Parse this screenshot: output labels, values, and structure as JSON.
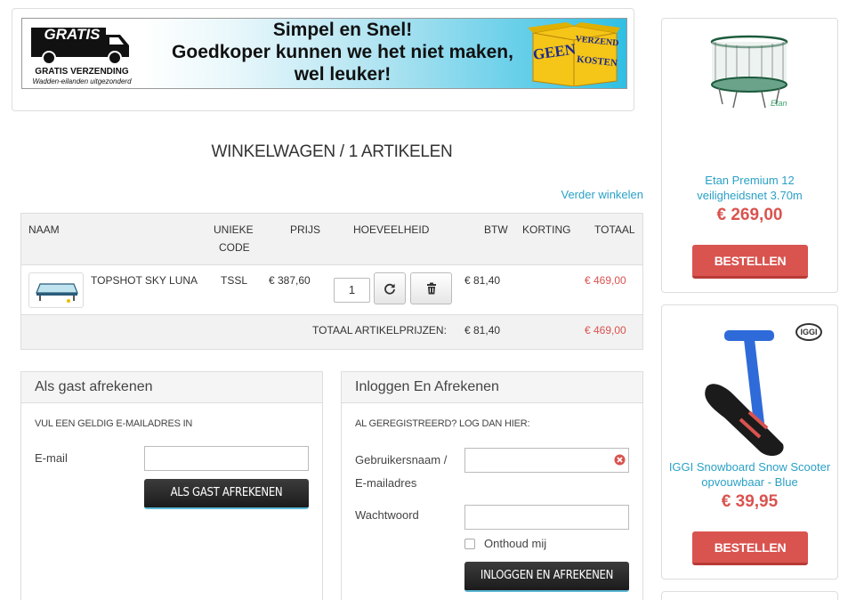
{
  "banner": {
    "gratis_badge": "GRATIS",
    "gratis_title": "GRATIS VERZENDING",
    "gratis_sub": "Wadden-eilanden uitgezonderd",
    "slogan_line1": "Simpel  en Snel!",
    "slogan_line2": "Goedkoper kunnen we het niet maken,",
    "slogan_line3": "wel leuker!",
    "box_geen": "GEEN",
    "box_verzend": "VERZEND",
    "box_kosten": "KOSTEN"
  },
  "page": {
    "title": "WINKELWAGEN / 1 ARTIKELEN",
    "continue_link": "Verder winkelen"
  },
  "cart": {
    "headers": {
      "name": "NAAM",
      "code_line1": "UNIEKE",
      "code_line2": "CODE",
      "price": "PRIJS",
      "quantity": "HOEVEELHEID",
      "vat": "BTW",
      "discount": "KORTING",
      "total": "TOTAAL"
    },
    "items": [
      {
        "name": "TOPSHOT SKY LUNA",
        "code": "TSSL",
        "price": "€ 387,60",
        "quantity": "1",
        "vat": "€ 81,40",
        "total": "€ 469,00"
      }
    ],
    "totals": {
      "label": "TOTAAL ARTIKELPRIJZEN:",
      "vat": "€ 81,40",
      "total": "€ 469,00"
    }
  },
  "guest_panel": {
    "title": "Als gast afrekenen",
    "note": "VUL EEN GELDIG E-MAILADRES IN",
    "email_label": "E-mail",
    "email_value": "",
    "button": "ALS GAST AFREKENEN"
  },
  "login_panel": {
    "title": "Inloggen En Afrekenen",
    "note": "AL GEREGISTREERD? LOG DAN HIER:",
    "username_label_line1": "Gebruikersnaam /",
    "username_label_line2": "E-mailadres",
    "username_value": "",
    "password_label": "Wachtwoord",
    "password_value": "",
    "remember_label": "Onthoud mij",
    "button": "INLOGGEN EN AFREKENEN"
  },
  "sidebar": {
    "products": [
      {
        "name_line1": "Etan Premium 12",
        "name_line2": "veiligheidsnet 3.70m",
        "price": "€ 269,00",
        "button": "BESTELLEN",
        "logo_text": "Etan"
      },
      {
        "name_line1": "IGGI Snowboard Snow Scooter",
        "name_line2": "opvouwbaar - Blue",
        "price": "€ 39,95",
        "button": "BESTELLEN",
        "logo_text": "IGGI"
      }
    ]
  },
  "colors": {
    "link": "#2aa0c6",
    "price_red": "#d9534f",
    "button_red": "#d9534f",
    "dark_button": "#222222"
  }
}
